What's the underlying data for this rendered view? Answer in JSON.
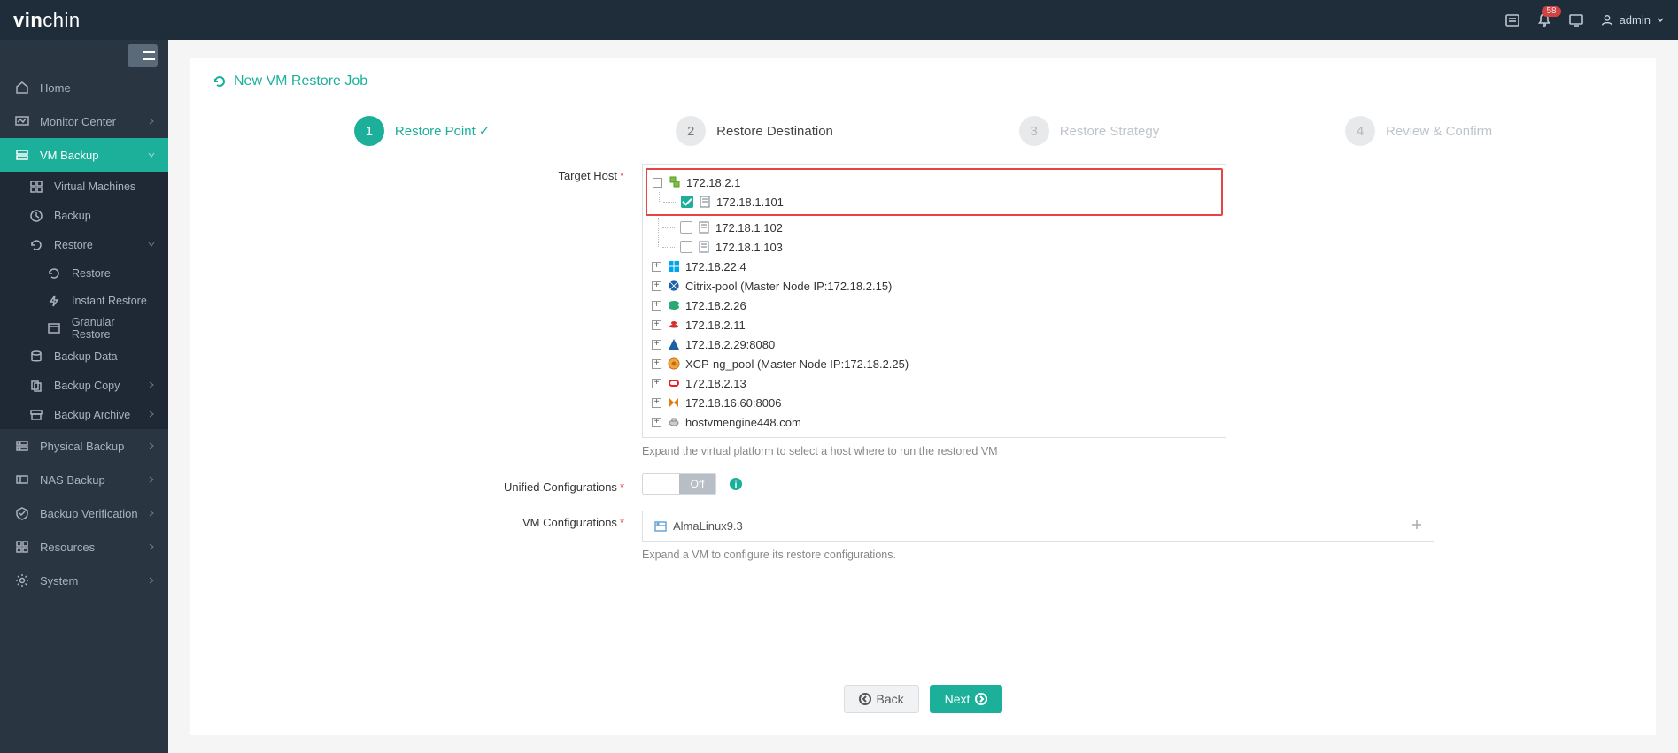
{
  "topbar": {
    "logo_text": "vinchin",
    "notification_count": "58",
    "user": "admin"
  },
  "sidebar": {
    "items": [
      {
        "label": "Home"
      },
      {
        "label": "Monitor Center"
      },
      {
        "label": "VM Backup"
      },
      {
        "label": "Physical Backup"
      },
      {
        "label": "NAS Backup"
      },
      {
        "label": "Backup Verification"
      },
      {
        "label": "Resources"
      },
      {
        "label": "System"
      }
    ],
    "vm_backup_sub": [
      {
        "label": "Virtual Machines"
      },
      {
        "label": "Backup"
      },
      {
        "label": "Restore"
      },
      {
        "label": "Backup Data"
      },
      {
        "label": "Backup Copy"
      },
      {
        "label": "Backup Archive"
      }
    ],
    "restore_sub": [
      {
        "label": "Restore"
      },
      {
        "label": "Instant Restore"
      },
      {
        "label": "Granular Restore"
      }
    ]
  },
  "page": {
    "title": "New VM Restore Job",
    "steps": [
      {
        "num": "1",
        "label": "Restore Point"
      },
      {
        "num": "2",
        "label": "Restore Destination"
      },
      {
        "num": "3",
        "label": "Restore Strategy"
      },
      {
        "num": "4",
        "label": "Review & Confirm"
      }
    ],
    "labels": {
      "target_host": "Target Host",
      "unified_conf": "Unified Configurations",
      "vm_conf": "VM Configurations"
    },
    "tree": {
      "root1": "172.18.2.1",
      "root1_children": [
        {
          "label": "172.18.1.101",
          "checked": true
        },
        {
          "label": "172.18.1.102",
          "checked": false
        },
        {
          "label": "172.18.1.103",
          "checked": false
        }
      ],
      "others": [
        {
          "label": "172.18.22.4",
          "ico": "windows"
        },
        {
          "label": "Citrix-pool (Master Node IP:172.18.2.15)",
          "ico": "citrix"
        },
        {
          "label": "172.18.2.26",
          "ico": "huawei"
        },
        {
          "label": "172.18.2.11",
          "ico": "redhat"
        },
        {
          "label": "172.18.2.29:8080",
          "ico": "azure"
        },
        {
          "label": "XCP-ng_pool (Master Node IP:172.18.2.25)",
          "ico": "xcp"
        },
        {
          "label": "172.18.2.13",
          "ico": "oracle"
        },
        {
          "label": "172.18.16.60:8006",
          "ico": "proxmox"
        },
        {
          "label": "hostvmengine448.com",
          "ico": "ovirt"
        }
      ]
    },
    "target_host_help": "Expand the virtual platform to select a host where to run the restored VM",
    "unified_toggle_off": "Off",
    "vmconf_vm": "AlmaLinux9.3",
    "vmconf_help": "Expand a VM to configure its restore configurations.",
    "back_btn": "Back",
    "next_btn": "Next"
  }
}
